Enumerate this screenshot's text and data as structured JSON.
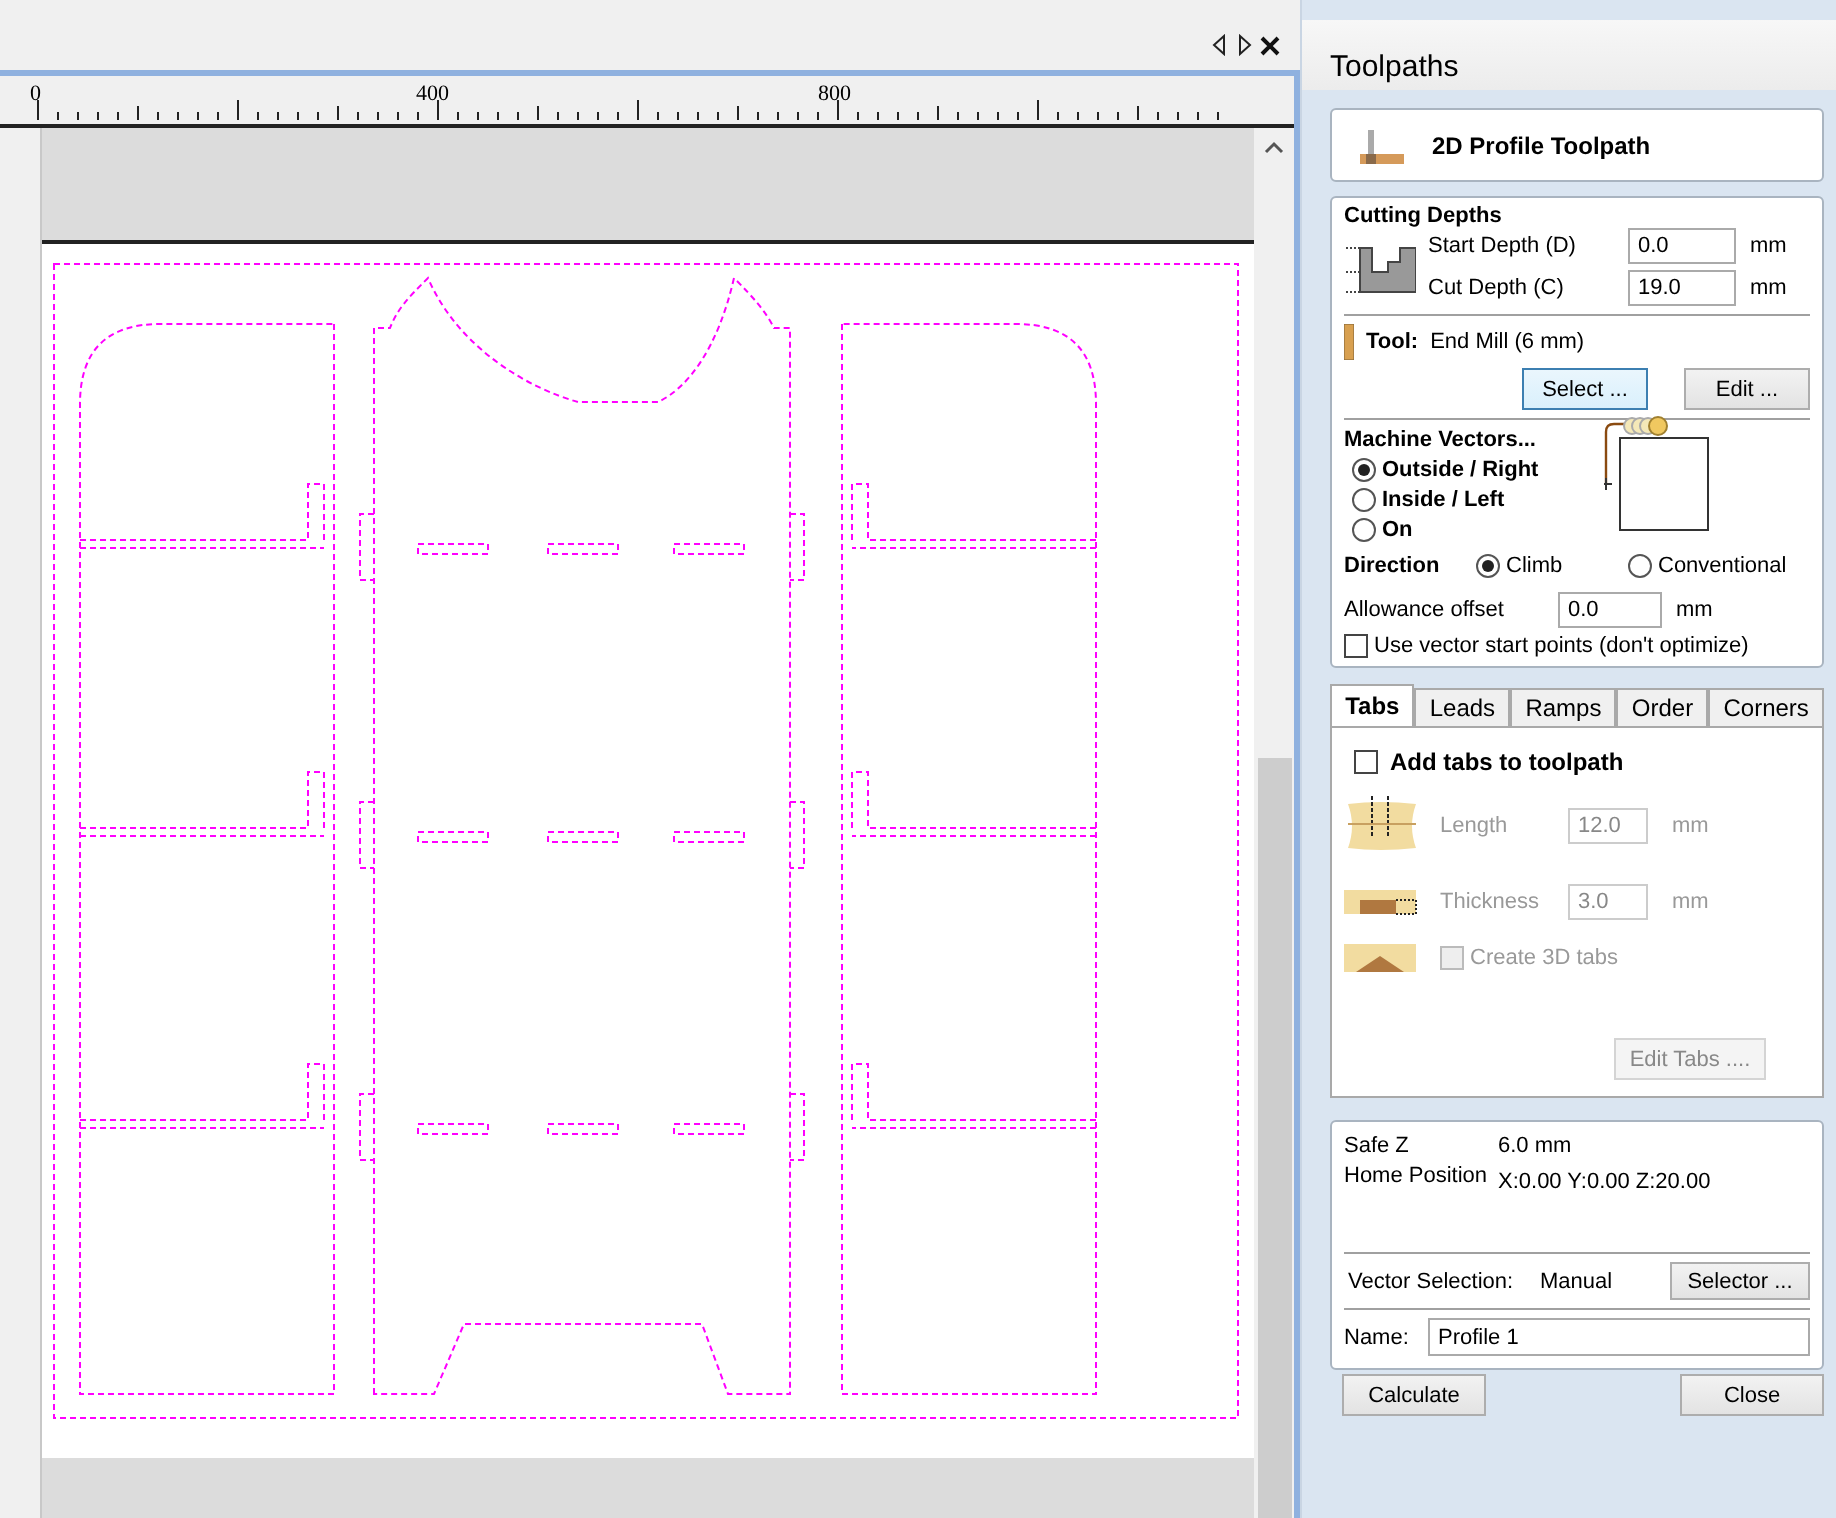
{
  "ruler": {
    "labels": [
      "0",
      "400",
      "800"
    ]
  },
  "panel": {
    "title": "Toolpaths",
    "header": "2D Profile Toolpath",
    "cutting_depths": {
      "title": "Cutting Depths",
      "fields": [
        {
          "label": "Start Depth (D)",
          "value": "0.0",
          "unit": "mm"
        },
        {
          "label": "Cut Depth (C)",
          "value": "19.0",
          "unit": "mm"
        }
      ]
    },
    "tool": {
      "label": "Tool:",
      "value": "End Mill (6 mm)",
      "buttons": [
        {
          "label": "Select ...",
          "focused": true
        },
        {
          "label": "Edit ...",
          "focused": false
        }
      ]
    },
    "machine_vectors": {
      "title": "Machine Vectors...",
      "options": [
        {
          "label": "Outside / Right",
          "selected": true
        },
        {
          "label": "Inside / Left",
          "selected": false
        },
        {
          "label": "On",
          "selected": false
        }
      ]
    },
    "direction": {
      "label": "Direction",
      "options": [
        {
          "label": "Climb",
          "selected": true
        },
        {
          "label": "Conventional",
          "selected": false
        }
      ]
    },
    "allowance": {
      "label": "Allowance offset",
      "value": "0.0",
      "unit": "mm"
    },
    "start_points": {
      "label": "Use vector start points (don't optimize)",
      "checked": false
    },
    "tabs": [
      {
        "label": "Tabs",
        "selected": true
      },
      {
        "label": "Leads",
        "selected": false
      },
      {
        "label": "Ramps",
        "selected": false
      },
      {
        "label": "Order",
        "selected": false
      },
      {
        "label": "Corners",
        "selected": false
      }
    ],
    "tabs_page": {
      "add_tabs": {
        "label": "Add tabs to toolpath",
        "checked": false
      },
      "fields": [
        {
          "label": "Length",
          "value": "12.0",
          "unit": "mm",
          "disabled": true
        },
        {
          "label": "Thickness",
          "value": "3.0",
          "unit": "mm",
          "disabled": true
        }
      ],
      "create_3d": {
        "label": "Create 3D tabs",
        "checked": false,
        "disabled": true
      },
      "edit_button": {
        "label": "Edit Tabs ....",
        "disabled": true
      }
    },
    "info": [
      {
        "label": "Safe Z",
        "value": "6.0 mm"
      },
      {
        "label": "Home Position",
        "value": "X:0.00 Y:0.00 Z:20.00"
      }
    ],
    "vector_selection": {
      "label": "Vector Selection:",
      "value": "Manual",
      "button": "Selector ..."
    },
    "name": {
      "label": "Name:",
      "value": "Profile 1"
    },
    "buttons": [
      "Calculate",
      "Close"
    ]
  }
}
